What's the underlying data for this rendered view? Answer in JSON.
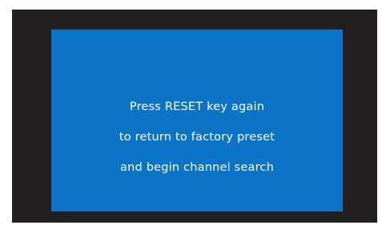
{
  "screen": {
    "message_lines": [
      "Press RESET key again",
      "to return to factory preset",
      "and begin channel search"
    ]
  },
  "colors": {
    "bezel": "#231f20",
    "screen_background": "#0b74c6",
    "text": "#ffffff"
  }
}
